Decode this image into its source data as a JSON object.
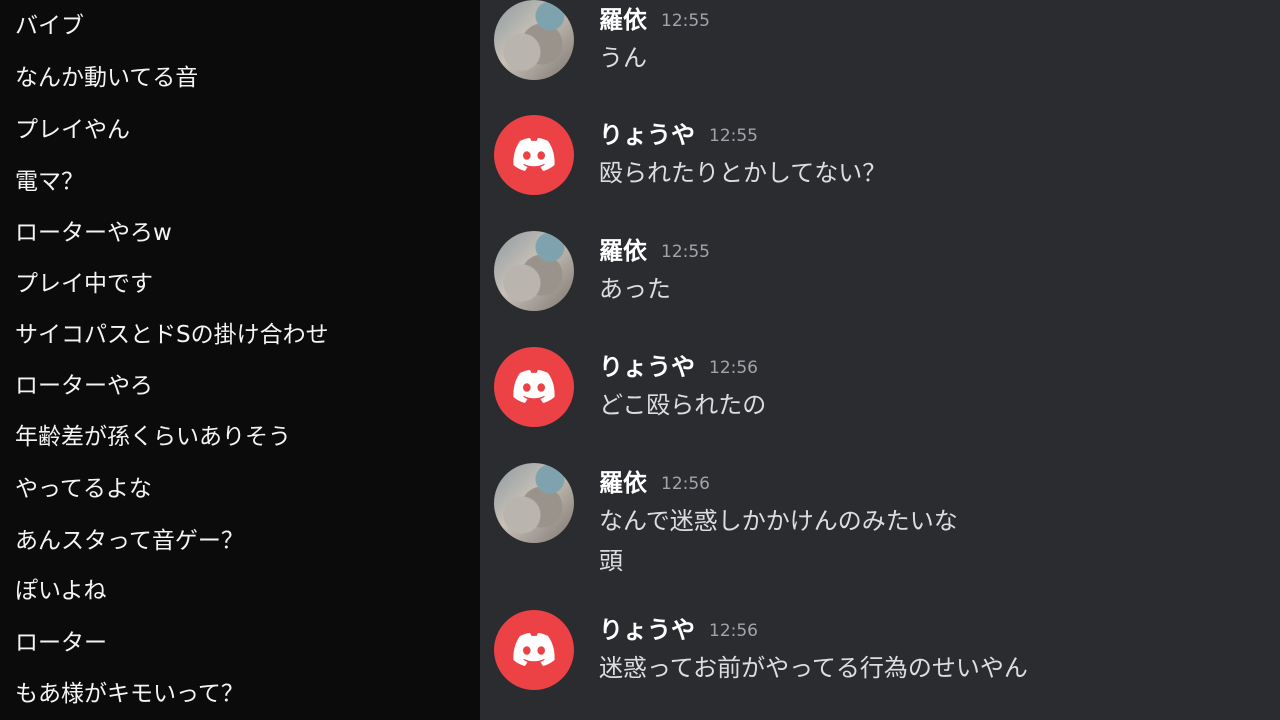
{
  "comments": [
    "バイブ",
    "なんか動いてる音",
    "プレイやん",
    "電マ？",
    "ローターやろw",
    "プレイ中です",
    "サイコパスとドSの掛け合わせ",
    "ローターやろ",
    "年齢差が孫くらいありそう",
    "やってるよな",
    "あんスタって音ゲー？",
    "ぽいよね",
    "ローター",
    "もあ様がキモいって？"
  ],
  "messages": [
    {
      "user": "羅依",
      "time": "12:55",
      "avatar": "user-photo",
      "lines": [
        "うん"
      ]
    },
    {
      "user": "りょうや",
      "time": "12:55",
      "avatar": "discord-logo",
      "lines": [
        "殴られたりとかしてない？"
      ]
    },
    {
      "user": "羅依",
      "time": "12:55",
      "avatar": "user-photo",
      "lines": [
        "あった"
      ]
    },
    {
      "user": "りょうや",
      "time": "12:56",
      "avatar": "discord-logo",
      "lines": [
        "どこ殴られたの"
      ]
    },
    {
      "user": "羅依",
      "time": "12:56",
      "avatar": "user-photo",
      "lines": [
        "なんで迷惑しかかけんのみたいな",
        "頭"
      ]
    },
    {
      "user": "りょうや",
      "time": "12:56",
      "avatar": "discord-logo",
      "lines": [
        "迷惑ってお前がやってる行為のせいやん"
      ]
    }
  ],
  "colors": {
    "discord_red": "#ed4245",
    "chat_background": "#2b2c30",
    "comment_background": "#0b0b0c"
  }
}
